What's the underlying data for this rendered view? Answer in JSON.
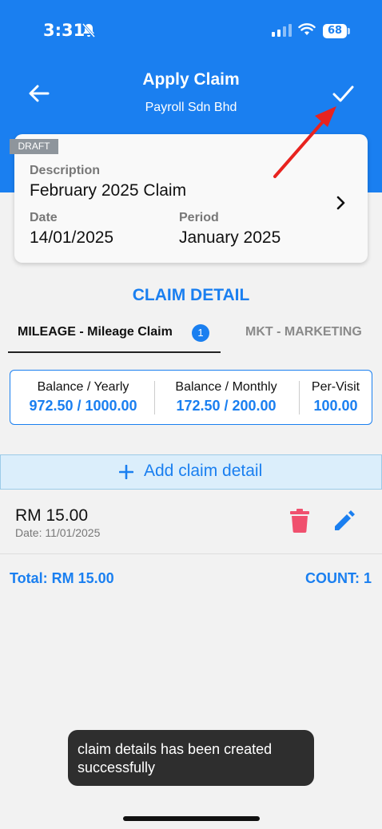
{
  "status_bar": {
    "time": "3:31",
    "battery": "68"
  },
  "header": {
    "title": "Apply Claim",
    "subtitle": "Payroll Sdn Bhd"
  },
  "claim_card": {
    "badge": "DRAFT",
    "description_label": "Description",
    "description_value": "February 2025 Claim",
    "date_label": "Date",
    "date_value": "14/01/2025",
    "period_label": "Period",
    "period_value": "January 2025"
  },
  "claim_detail": {
    "section_title": "CLAIM DETAIL",
    "tabs": [
      {
        "label": "MILEAGE - Mileage Claim",
        "count": "1",
        "active": true
      },
      {
        "label": "MKT - MARKETING",
        "active": false
      }
    ],
    "balances": [
      {
        "label": "Balance / Yearly",
        "value": "972.50 / 1000.00"
      },
      {
        "label": "Balance / Monthly",
        "value": "172.50 / 200.00"
      },
      {
        "label": "Per-Visit",
        "value": "100.00"
      }
    ],
    "add_label": "Add claim detail",
    "items": [
      {
        "amount": "RM 15.00",
        "date": "Date: 11/01/2025"
      }
    ],
    "total": "Total: RM 15.00",
    "count": "COUNT: 1"
  },
  "toast": {
    "message": "claim details has been created successfully"
  },
  "colors": {
    "primary": "#1a7ff0",
    "delete": "#f0506e",
    "annotation": "#e8231f"
  }
}
